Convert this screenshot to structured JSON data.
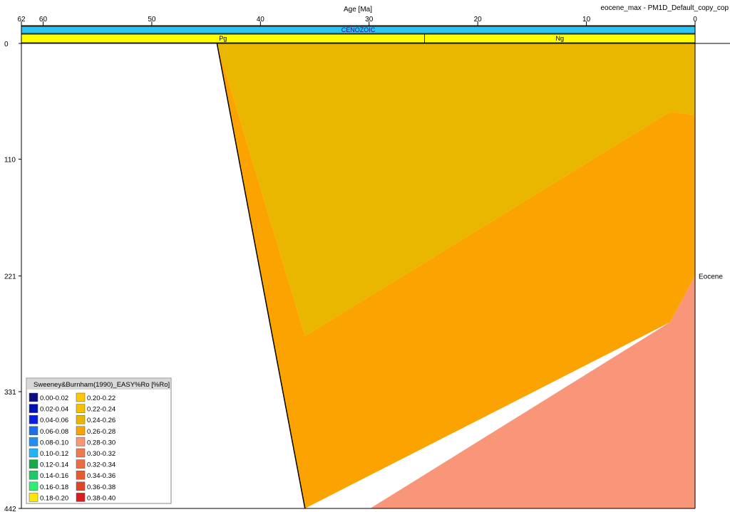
{
  "window_title": "eocene_max - PM1D_Default_copy_cop",
  "chart_data": {
    "type": "area",
    "title": "",
    "xlabel": "Age [Ma]",
    "ylabel": "",
    "x_reversed": true,
    "xlim": [
      62,
      0
    ],
    "ylim": [
      0,
      442
    ],
    "x_ticks": [
      62,
      60,
      50,
      40,
      30,
      20,
      10,
      0
    ],
    "y_ticks": [
      0,
      110,
      221,
      331,
      442
    ],
    "grid": false,
    "layer_labels": [
      {
        "label": "Eocene",
        "depth": 221
      }
    ],
    "chronostratigraphy": {
      "era": {
        "label": "CENOZOIC",
        "start": 62,
        "end": 0,
        "color": "#2ec3f0"
      },
      "periods": [
        {
          "label": "Pg",
          "start": 62,
          "end": 24.9,
          "color": "#ffff00"
        },
        {
          "label": "Ng",
          "start": 24.9,
          "end": 0,
          "color": "#ffff00"
        }
      ]
    },
    "basin_onset": {
      "age": 44,
      "surface_depth": 0,
      "base_age": 35.9,
      "base_depth": 442
    },
    "zones": [
      {
        "range": "0.20-0.22",
        "color": "#ffc800",
        "polygon": [
          [
            38.7,
            0
          ],
          [
            24.9,
            0
          ],
          [
            35.9,
            70
          ]
        ]
      },
      {
        "range": "0.24-0.26",
        "color": "#eab700",
        "polygon": [
          [
            44,
            0
          ],
          [
            0,
            0
          ],
          [
            0,
            68
          ],
          [
            2.3,
            65
          ],
          [
            26.7,
            220
          ],
          [
            35.9,
            278
          ],
          [
            44,
            0
          ]
        ]
      },
      {
        "range": "0.26-0.28",
        "color": "#fba300",
        "polygon": [
          [
            44,
            0
          ],
          [
            35.9,
            278
          ],
          [
            26.7,
            220
          ],
          [
            2.3,
            65
          ],
          [
            0,
            68
          ],
          [
            0,
            221
          ],
          [
            2.3,
            265
          ],
          [
            35.9,
            442
          ],
          [
            44,
            0
          ]
        ]
      },
      {
        "range": "0.28-0.30",
        "color": "#f9967a",
        "polygon": [
          [
            0,
            221
          ],
          [
            2.3,
            265
          ],
          [
            29.9,
            442
          ],
          [
            0,
            442
          ]
        ]
      }
    ],
    "legend": {
      "title": "Sweeney&Burnham(1990)_EASY%Ro [%Ro]",
      "position": "bottom-left",
      "columns": [
        [
          {
            "label": "0.00-0.02",
            "color": "#0a0f80"
          },
          {
            "label": "0.02-0.04",
            "color": "#0010b0"
          },
          {
            "label": "0.04-0.06",
            "color": "#0a1ee0"
          },
          {
            "label": "0.06-0.08",
            "color": "#1c6ef0"
          },
          {
            "label": "0.08-0.10",
            "color": "#1e8ef8"
          },
          {
            "label": "0.10-0.12",
            "color": "#22b4f8"
          },
          {
            "label": "0.12-0.14",
            "color": "#18a84a"
          },
          {
            "label": "0.14-0.16",
            "color": "#1ec864"
          },
          {
            "label": "0.16-0.18",
            "color": "#2cf070"
          },
          {
            "label": "0.18-0.20",
            "color": "#ffe800"
          }
        ],
        [
          {
            "label": "0.20-0.22",
            "color": "#ffc800"
          },
          {
            "label": "0.22-0.24",
            "color": "#f4c000"
          },
          {
            "label": "0.24-0.26",
            "color": "#eab700"
          },
          {
            "label": "0.26-0.28",
            "color": "#fba300"
          },
          {
            "label": "0.28-0.30",
            "color": "#f9967a"
          },
          {
            "label": "0.30-0.32",
            "color": "#f07a50"
          },
          {
            "label": "0.32-0.34",
            "color": "#ee6a40"
          },
          {
            "label": "0.34-0.36",
            "color": "#e85a30"
          },
          {
            "label": "0.36-0.38",
            "color": "#e24424"
          },
          {
            "label": "0.38-0.40",
            "color": "#dc1c1c"
          }
        ]
      ]
    }
  }
}
